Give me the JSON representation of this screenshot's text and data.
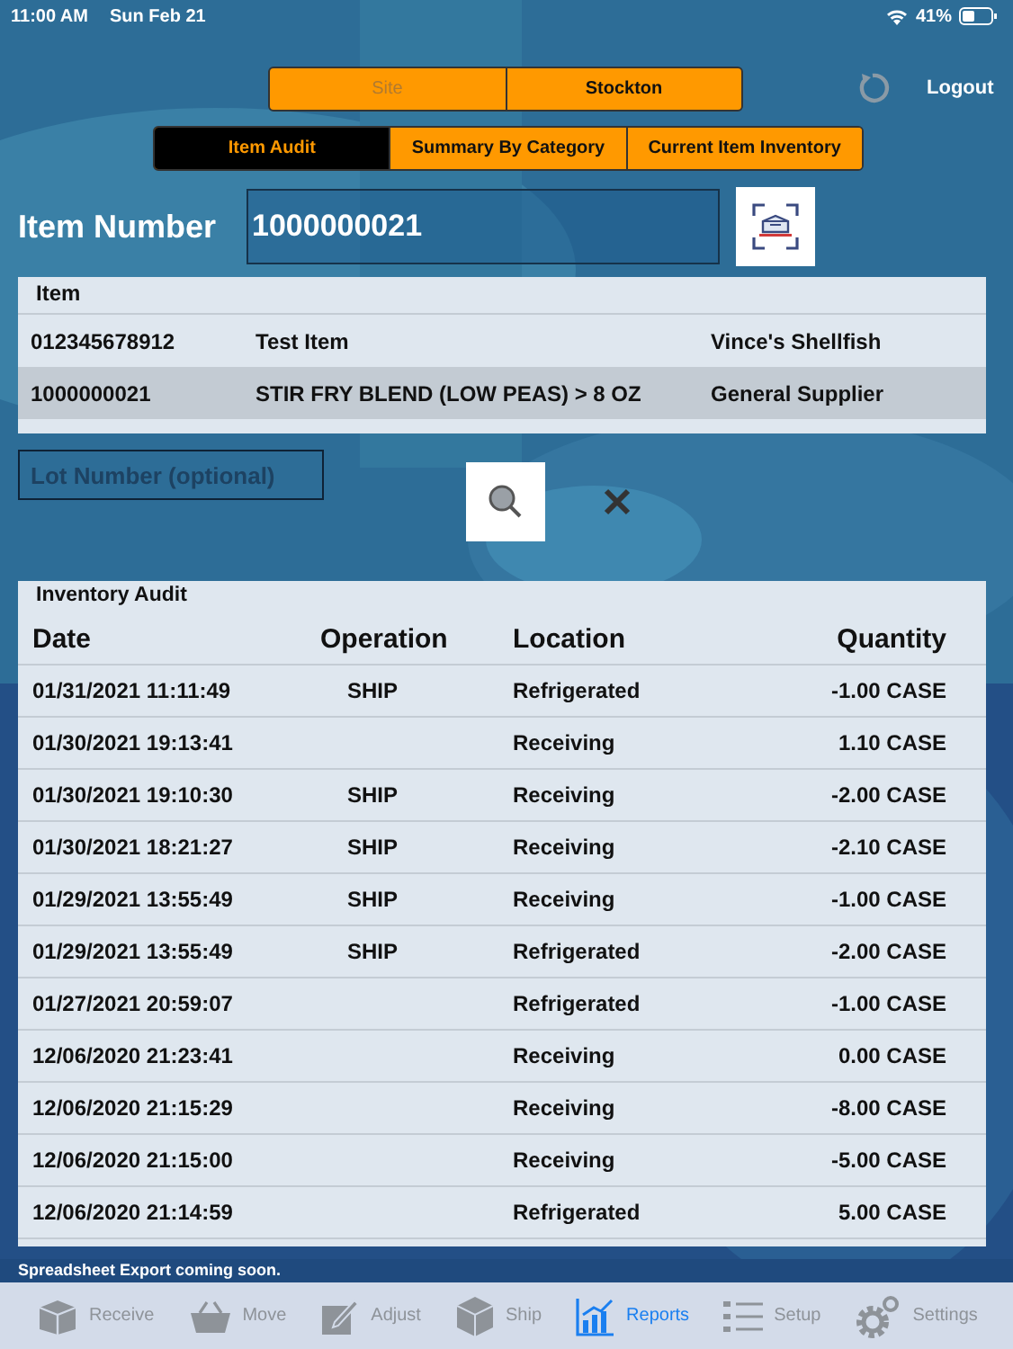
{
  "status_bar": {
    "time": "11:00 AM",
    "date": "Sun Feb 21",
    "battery": "41%"
  },
  "site": {
    "label": "Site",
    "value": "Stockton"
  },
  "logout": "Logout",
  "tabs": [
    {
      "label": "Item Audit",
      "selected": true
    },
    {
      "label": "Summary By Category",
      "selected": false
    },
    {
      "label": "Current Item Inventory",
      "selected": false
    }
  ],
  "item_number": {
    "label": "Item Number",
    "value": "1000000021"
  },
  "item_table": {
    "heading": "Item",
    "rows": [
      {
        "code": "012345678912",
        "name": "Test Item",
        "supplier": "Vince's Shellfish",
        "selected": false
      },
      {
        "code": "1000000021",
        "name": "STIR FRY BLEND (LOW PEAS) > 8 OZ",
        "supplier": "General Supplier",
        "selected": true
      }
    ]
  },
  "lot_field": {
    "placeholder": "Lot Number (optional)"
  },
  "inventory": {
    "title": "Inventory Audit",
    "columns": [
      "Date",
      "Operation",
      "Location",
      "Quantity"
    ],
    "rows": [
      [
        "01/31/2021 11:11:49",
        "SHIP",
        "Refrigerated",
        "-1.00 CASE"
      ],
      [
        "01/30/2021 19:13:41",
        "",
        "Receiving",
        "1.10 CASE"
      ],
      [
        "01/30/2021 19:10:30",
        "SHIP",
        "Receiving",
        "-2.00 CASE"
      ],
      [
        "01/30/2021 18:21:27",
        "SHIP",
        "Receiving",
        "-2.10 CASE"
      ],
      [
        "01/29/2021 13:55:49",
        "SHIP",
        "Receiving",
        "-1.00 CASE"
      ],
      [
        "01/29/2021 13:55:49",
        "SHIP",
        "Refrigerated",
        "-2.00 CASE"
      ],
      [
        "01/27/2021 20:59:07",
        "",
        "Refrigerated",
        "-1.00 CASE"
      ],
      [
        "12/06/2020 21:23:41",
        "",
        "Receiving",
        "0.00 CASE"
      ],
      [
        "12/06/2020 21:15:29",
        "",
        "Receiving",
        "-8.00 CASE"
      ],
      [
        "12/06/2020 21:15:00",
        "",
        "Receiving",
        "-5.00 CASE"
      ],
      [
        "12/06/2020 21:14:59",
        "",
        "Refrigerated",
        "5.00 CASE"
      ]
    ]
  },
  "footer_note": "Spreadsheet Export coming soon.",
  "tab_bar": [
    {
      "kind": "receive",
      "label": "Receive",
      "selected": false
    },
    {
      "kind": "move",
      "label": "Move",
      "selected": false
    },
    {
      "kind": "adjust",
      "label": "Adjust",
      "selected": false
    },
    {
      "kind": "ship",
      "label": "Ship",
      "selected": false
    },
    {
      "kind": "reports",
      "label": "Reports",
      "selected": true
    },
    {
      "kind": "setup",
      "label": "Setup",
      "selected": false
    },
    {
      "kind": "settings",
      "label": "Settings",
      "selected": false
    }
  ]
}
